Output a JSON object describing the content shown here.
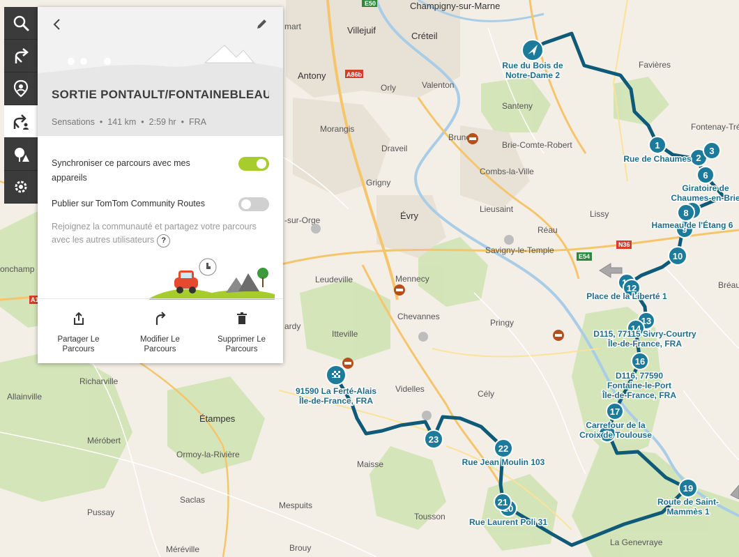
{
  "map": {
    "places": [
      {
        "name": "Champigny-sur-Marne",
        "size": "big"
      },
      {
        "name": "Villejuif",
        "size": "big"
      },
      {
        "name": "Créteil",
        "size": "big"
      },
      {
        "name": "Antony",
        "size": "big"
      },
      {
        "name": "Orly",
        "size": "small"
      },
      {
        "name": "Valenton",
        "size": "small"
      },
      {
        "name": "Santeny",
        "size": "small"
      },
      {
        "name": "Favières",
        "size": "small"
      },
      {
        "name": "Fontenay-Tré",
        "size": "small"
      },
      {
        "name": "Morangis",
        "size": "small"
      },
      {
        "name": "Brunoy",
        "size": "small"
      },
      {
        "name": "Brie-Comte-Robert",
        "size": "small"
      },
      {
        "name": "Draveil",
        "size": "small"
      },
      {
        "name": "Combs-la-Ville",
        "size": "small"
      },
      {
        "name": "Grigny",
        "size": "small"
      },
      {
        "name": "Évry",
        "size": "big"
      },
      {
        "name": "Lieusaint",
        "size": "small"
      },
      {
        "name": "Lissy",
        "size": "small"
      },
      {
        "name": "Réau",
        "size": "small"
      },
      {
        "name": "Savigny-le-Temple",
        "size": "small"
      },
      {
        "name": "Leudeville",
        "size": "small"
      },
      {
        "name": "Mennecy",
        "size": "small"
      },
      {
        "name": "Chevannes",
        "size": "small"
      },
      {
        "name": "Pringy",
        "size": "small"
      },
      {
        "name": "Itteville",
        "size": "small"
      },
      {
        "name": "Richarville",
        "size": "small"
      },
      {
        "name": "Allainville",
        "size": "small"
      },
      {
        "name": "Étampes",
        "size": "big"
      },
      {
        "name": "Videlles",
        "size": "small"
      },
      {
        "name": "Cély",
        "size": "small"
      },
      {
        "name": "Méróbert",
        "size": "small"
      },
      {
        "name": "Ormoy-la-Rivière",
        "size": "small"
      },
      {
        "name": "Maisse",
        "size": "small"
      },
      {
        "name": "Saclas",
        "size": "small"
      },
      {
        "name": "Mespuits",
        "size": "small"
      },
      {
        "name": "Pussay",
        "size": "small"
      },
      {
        "name": "Tousson",
        "size": "small"
      },
      {
        "name": "Brouy",
        "size": "small"
      },
      {
        "name": "Méréville",
        "size": "small"
      },
      {
        "name": "La Genevraye",
        "size": "small"
      },
      {
        "name": "Bréau",
        "size": "small"
      },
      {
        "name": "onchamp",
        "size": "small"
      },
      {
        "name": "-sur-Orge",
        "size": "small"
      },
      {
        "name": "ardy",
        "size": "small"
      },
      {
        "name": "mart",
        "size": "small"
      }
    ],
    "road_shields": [
      "E50",
      "A86b",
      "E54",
      "N36",
      "A1"
    ],
    "waypoint_labels": [
      "Rue du Bois de\nNotre-Dame 2",
      "Rue de Chaumes",
      "Giratoire de\nChaumes-en-Brie",
      "Hameau de l'Étang 6",
      "Place de la Liberté 1",
      "D115, 77115 Sivry-Courtry\nÎle-de-France, FRA",
      "D116, 77590\nFontaine-le-Port\nÎle-de-France, FRA",
      "Carrefour de la\nCroix de Toulouse",
      "Route de Saint-\nMammès 1",
      "Rue Laurent Poli 31",
      "Rue Jean Moulin 103",
      "91590 La Ferté-Alais\nÎle-de-France, FRA"
    ],
    "waypoint_numbers": [
      "1",
      "2",
      "3",
      "6",
      "7",
      "8",
      "9",
      "10",
      "11",
      "12",
      "13",
      "14",
      "16",
      "17",
      "18",
      "19",
      "20",
      "21",
      "22",
      "23"
    ],
    "route_color": "#0e5a78",
    "marker_color": "#1c7a9a"
  },
  "toolbar": {
    "items": [
      {
        "icon": "search-icon"
      },
      {
        "icon": "route-planner-icon"
      },
      {
        "icon": "places-icon"
      },
      {
        "icon": "my-routes-icon"
      },
      {
        "icon": "poi-icon"
      },
      {
        "icon": "settings-icon"
      }
    ]
  },
  "panel": {
    "title": "SORTIE PONTAULT/FONTAINEBLEAU/CE",
    "meta": {
      "type": "Sensations",
      "distance": "141 km",
      "duration": "2:59 hr",
      "country": "FRA"
    },
    "sync_label": "Synchroniser ce parcours avec mes appareils",
    "sync_on": true,
    "publish_label": "Publier sur TomTom Community Routes",
    "publish_on": false,
    "community_note": "Rejoignez la communauté et partagez votre parcours avec les autres utilisateurs",
    "help_label": "?",
    "actions": [
      {
        "label": "Partager Le\nParcours",
        "icon": "share-icon"
      },
      {
        "label": "Modifier Le\nParcours",
        "icon": "modify-route-icon"
      },
      {
        "label": "Supprimer Le\nParcours",
        "icon": "trash-icon"
      }
    ]
  }
}
